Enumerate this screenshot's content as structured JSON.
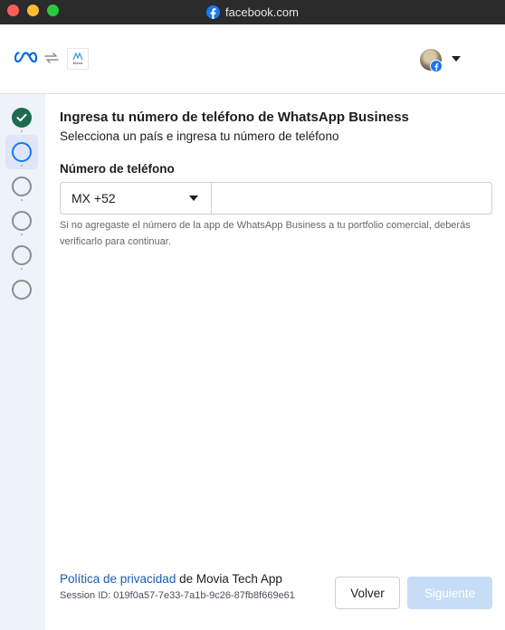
{
  "window": {
    "title": "facebook.com"
  },
  "header": {
    "brand_icon": "meta-logo-icon",
    "connect_icon": "swap-arrows-icon",
    "app_thumbnail_text": "Movia",
    "account_icon": "facebook-badge-icon"
  },
  "stepper": {
    "steps": [
      {
        "state": "done",
        "icon": "check-icon"
      },
      {
        "state": "current"
      },
      {
        "state": "todo"
      },
      {
        "state": "todo"
      },
      {
        "state": "todo"
      },
      {
        "state": "todo"
      }
    ]
  },
  "main": {
    "title": "Ingresa tu número de teléfono de WhatsApp Business",
    "subtitle": "Selecciona un país e ingresa tu número de teléfono",
    "phone_label": "Número de teléfono",
    "country_code": "MX +52",
    "phone_value": "",
    "phone_placeholder": "",
    "helper_text": "Si no agregaste el número de la app de WhatsApp Business a tu portfolio comercial, deberás verificarlo para continuar."
  },
  "footer": {
    "privacy_link": "Política de privacidad",
    "privacy_suffix": " de Movia Tech App",
    "session_id": "Session ID: 019f0a57-7e33-7a1b-9c26-87fb8f669e61",
    "back_label": "Volver",
    "next_label": "Siguiente"
  },
  "colors": {
    "accent": "#1877f2",
    "step_done": "#1e6b52",
    "next_disabled": "#c7dcf5",
    "link": "#1b5bb6"
  }
}
